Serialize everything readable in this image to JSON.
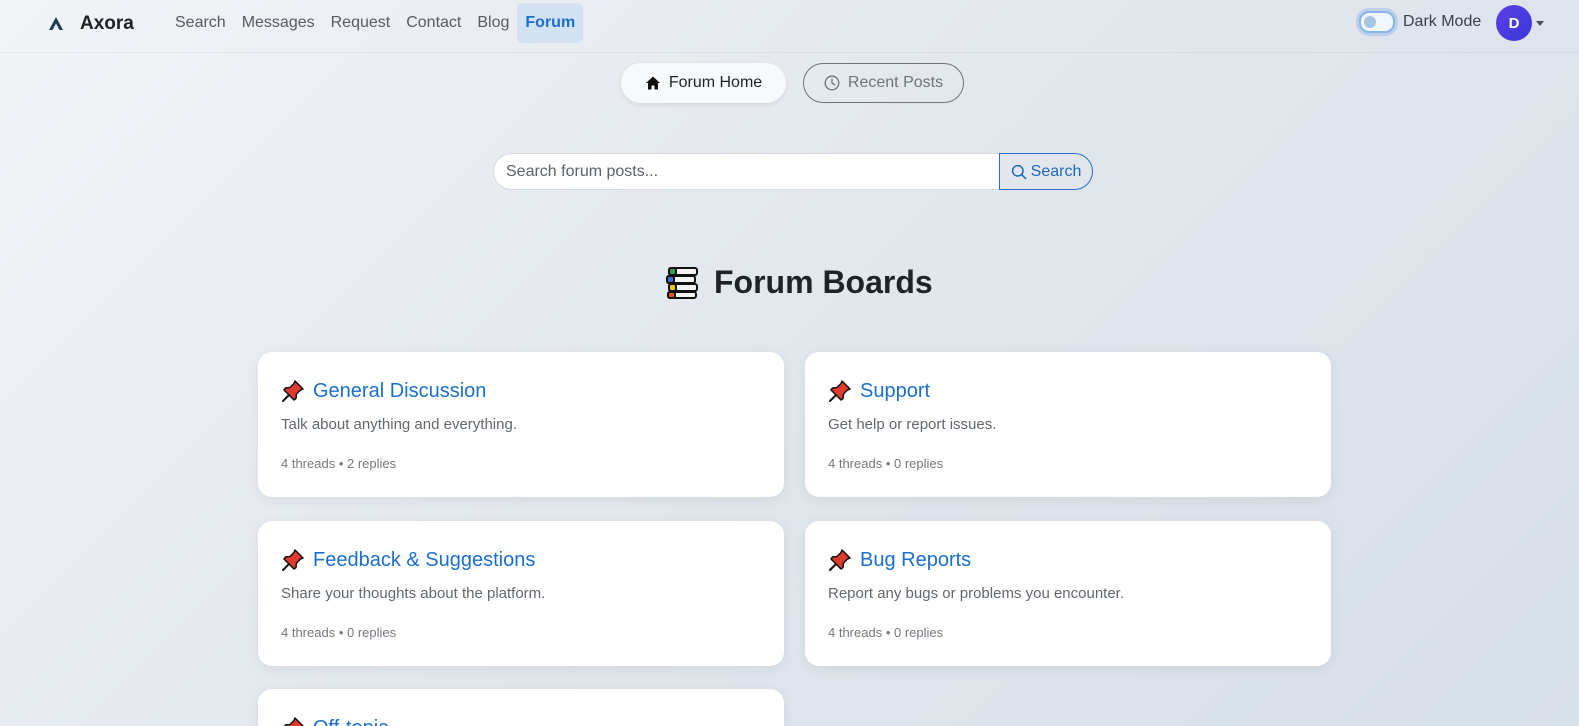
{
  "brand": {
    "name": "Axora",
    "logo_icon": "axora-logo-icon"
  },
  "nav": {
    "links": [
      {
        "label": "Search",
        "active": false
      },
      {
        "label": "Messages",
        "active": false
      },
      {
        "label": "Request",
        "active": false
      },
      {
        "label": "Contact",
        "active": false
      },
      {
        "label": "Blog",
        "active": false
      },
      {
        "label": "Forum",
        "active": true
      }
    ],
    "dark_mode_label": "Dark Mode",
    "dark_mode_on": false,
    "avatar_initial": "D"
  },
  "forum_nav": {
    "home_label": "Forum Home",
    "home_icon": "house-icon",
    "recent_label": "Recent Posts",
    "recent_icon": "clock-icon"
  },
  "search": {
    "placeholder": "Search forum posts...",
    "button_label": "Search",
    "icon": "magnifier-icon"
  },
  "heading": {
    "text": "Forum Boards",
    "icon": "books-icon"
  },
  "boards": [
    {
      "title": "General Discussion",
      "description": "Talk about anything and everything.",
      "stats": "4 threads • 2 replies"
    },
    {
      "title": "Support",
      "description": "Get help or report issues.",
      "stats": "4 threads • 0 replies"
    },
    {
      "title": "Feedback & Suggestions",
      "description": "Share your thoughts about the platform.",
      "stats": "4 threads • 0 replies"
    },
    {
      "title": "Bug Reports",
      "description": "Report any bugs or problems you encounter.",
      "stats": "4 threads • 0 replies"
    },
    {
      "title": "Off-topic",
      "description": "",
      "stats": ""
    }
  ],
  "colors": {
    "accent": "#1a6fd0",
    "active_nav_bg": "#d3e2f2",
    "avatar_bg": "#4a3be0",
    "pin_red": "#e03a2f"
  }
}
